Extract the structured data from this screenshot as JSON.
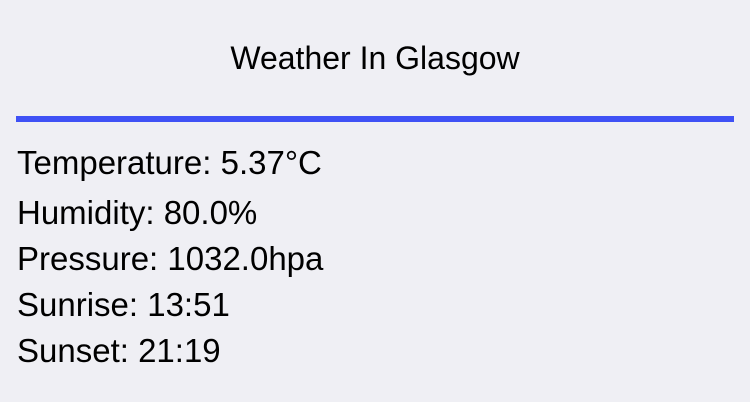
{
  "header": {
    "title": "Weather In Glasgow"
  },
  "colors": {
    "background": "#efeff4",
    "divider": "#3f51f5",
    "text": "#000000"
  },
  "details": {
    "temperature": "Temperature: 5.37°C",
    "humidity": "Humidity: 80.0%",
    "pressure": "Pressure: 1032.0hpa",
    "sunrise": "Sunrise: 13:51",
    "sunset": "Sunset: 21:19"
  }
}
